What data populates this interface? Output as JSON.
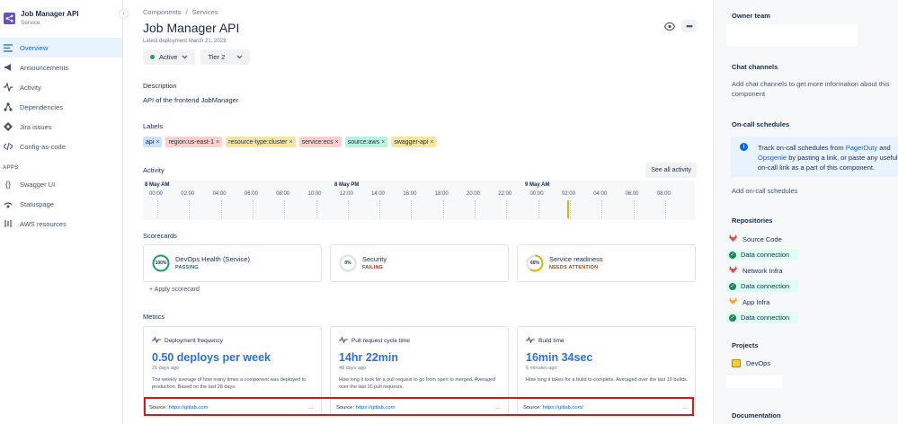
{
  "app": {
    "title": "Job Manager API",
    "subtitle": "Service"
  },
  "sidebar": {
    "items": [
      {
        "label": "Overview",
        "icon": "overview-icon",
        "active": true
      },
      {
        "label": "Announcements",
        "icon": "megaphone-icon"
      },
      {
        "label": "Activity",
        "icon": "activity-icon"
      },
      {
        "label": "Dependencies",
        "icon": "dependencies-icon"
      },
      {
        "label": "Jira issues",
        "icon": "jira-icon"
      },
      {
        "label": "Config-as-code",
        "icon": "code-icon"
      }
    ],
    "apps_label": "APPS",
    "apps": [
      {
        "label": "Swagger UI",
        "icon": "swagger-icon"
      },
      {
        "label": "Statuspage",
        "icon": "statuspage-icon"
      },
      {
        "label": "AWS resources",
        "icon": "aws-icon"
      }
    ]
  },
  "header": {
    "breadcrumb": [
      "Components",
      "Services"
    ],
    "breadcrumb_sep": "/",
    "title": "Job Manager API",
    "latest_deployment": "Latest deployment March 21, 2023",
    "status": "Active",
    "tier": "Tier 2",
    "more": "•••"
  },
  "description": {
    "heading": "Description",
    "text": "API of the frontend JobManager."
  },
  "labels": {
    "heading": "Labels",
    "remove_glyph": "×",
    "items": [
      {
        "text": "api",
        "color": "#cce0ff"
      },
      {
        "text": "region:us-east-1",
        "color": "#fdd0cc"
      },
      {
        "text": "resource-type:cluster",
        "color": "#f8e6a0"
      },
      {
        "text": "service:ecs",
        "color": "#fdd0cc"
      },
      {
        "text": "source:aws",
        "color": "#baf3db"
      },
      {
        "text": "swagger-api",
        "color": "#f8e6a0"
      }
    ]
  },
  "activity": {
    "heading": "Activity",
    "see_all": "See all activity",
    "days": [
      "8 May AM",
      "8 May PM",
      "9 May AM"
    ],
    "hours": [
      "00:00",
      "02:00",
      "04:00",
      "06:00",
      "08:00",
      "10:00",
      "12:00",
      "14:00",
      "16:00",
      "18:00",
      "20:00",
      "22:00",
      "00:00",
      "02:00",
      "04:00",
      "06:00",
      "08:00"
    ]
  },
  "scorecards": {
    "heading": "Scorecards",
    "items": [
      {
        "name": "DevOps Health (Service)",
        "status": "PASSING",
        "percent": 100,
        "percent_label": "100%",
        "ring_color": "#22a06b",
        "status_color": "#216e4e"
      },
      {
        "name": "Security",
        "status": "FAILING",
        "percent": 0,
        "percent_label": "0%",
        "ring_color": "#dcdfe4",
        "status_color": "#ae2e24"
      },
      {
        "name": "Service readiness",
        "status": "NEEDS ATTENTION",
        "percent": 60,
        "percent_label": "60%",
        "ring_color": "#e2b203",
        "status_color": "#a54800"
      }
    ],
    "apply": "+  Apply scorecard"
  },
  "metrics": {
    "heading": "Metrics",
    "source_prefix": "Source:",
    "more": "...",
    "items": [
      {
        "name": "Deployment frequency",
        "value": "0.50 deploys per week",
        "ago": "21 days ago",
        "desc": "The weekly average of how many times a component was deployed to production. Based on the last 28 days.",
        "source": "https://gitlab.com"
      },
      {
        "name": "Pull request cycle time",
        "value": "14hr 22min",
        "ago": "48 days ago",
        "desc": "How long it took for a pull request to go from open to merged. Averaged over the last 10 pull requests.",
        "source": "https://gitlab.com"
      },
      {
        "name": "Build time",
        "value": "16min 34sec",
        "ago": "6 minutes ago",
        "desc": "How long it takes for a build to complete. Averaged over the last 10 builds.",
        "source": "https://gitlab.com/"
      }
    ]
  },
  "right_panel": {
    "owner_team": "Owner team",
    "chat_channels": "Chat channels",
    "chat_text": "Add chat channels to get more information about this component",
    "oncall": "On-call schedules",
    "oncall_info_1": "Track on-call schedules from",
    "oncall_pagerduty": "PagerDuty",
    "oncall_and": "and",
    "oncall_opsgenie": "Opsgenie",
    "oncall_info_2": "by pasting a link, or paste any useful on-call link as a part of this component.",
    "add_oncall": "Add on-call schedules",
    "repositories": "Repositories",
    "repos": [
      {
        "name": "Source Code",
        "connection": "Data connection"
      },
      {
        "name": "Network Infra",
        "connection": "Data connection"
      },
      {
        "name": "App Infra",
        "connection": "Data connection"
      }
    ],
    "projects": "Projects",
    "project": "DevOps",
    "documentation": "Documentation"
  }
}
